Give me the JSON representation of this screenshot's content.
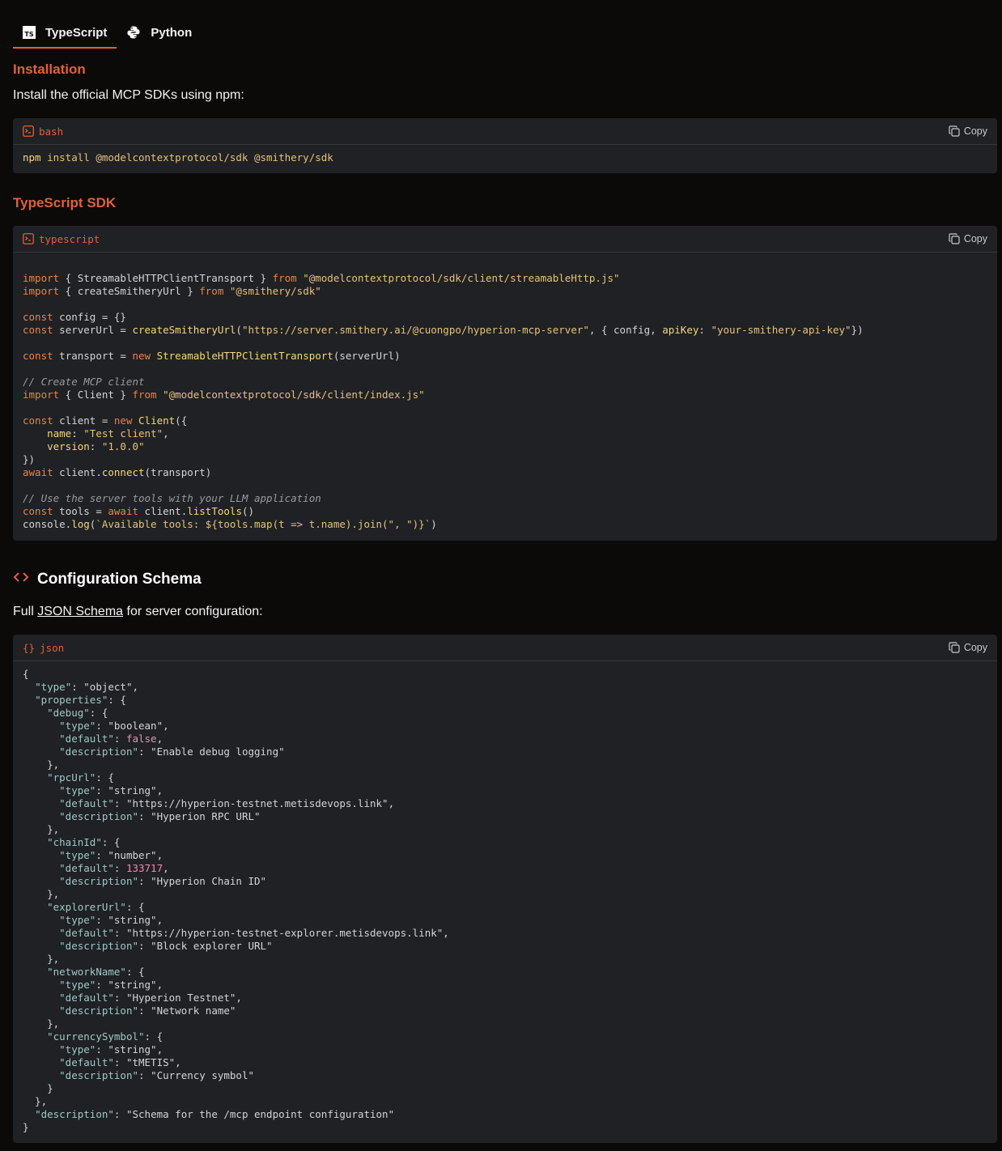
{
  "tabs": [
    {
      "label": "TypeScript",
      "active": true,
      "icon": "typescript-icon"
    },
    {
      "label": "Python",
      "active": false,
      "icon": "python-icon"
    }
  ],
  "installation": {
    "heading": "Installation",
    "text": "Install the official MCP SDKs using npm:",
    "block": {
      "lang": "bash",
      "copy": "Copy",
      "cmd": "npm",
      "args": "install @modelcontextprotocol/sdk @smithery/sdk"
    }
  },
  "ts_sdk": {
    "heading": "TypeScript SDK",
    "block": {
      "lang": "typescript",
      "copy": "Copy",
      "strings": {
        "transport_path": "\"@modelcontextprotocol/sdk/client/streamableHttp.js\"",
        "smithery_path": "\"@smithery/sdk\"",
        "server_url": "\"https://server.smithery.ai/@cuongpo/hyperion-mcp-server\"",
        "api_key": "\"your-smithery-api-key\"",
        "comment_create": "// Create MCP client",
        "client_path": "\"@modelcontextprotocol/sdk/client/index.js\"",
        "client_name": "\"Test client\"",
        "client_version": "\"1.0.0\"",
        "comment_use": "// Use the server tools with your LLM application",
        "log_template": "`Available tools: ${tools.map(t => t.name).join(\", \")}`"
      }
    }
  },
  "config_schema": {
    "heading": "Configuration Schema",
    "text_prefix": "Full ",
    "link": "JSON Schema",
    "text_suffix": " for server configuration:",
    "block": {
      "lang": "json",
      "copy": "Copy"
    },
    "properties": [
      {
        "name": "debug",
        "type": "boolean",
        "default": "false",
        "default_kind": "literal",
        "description": "Enable debug logging"
      },
      {
        "name": "rpcUrl",
        "type": "string",
        "default": "https://hyperion-testnet.metisdevops.link",
        "default_kind": "string",
        "description": "Hyperion RPC URL"
      },
      {
        "name": "chainId",
        "type": "number",
        "default": "133717",
        "default_kind": "literal",
        "description": "Hyperion Chain ID"
      },
      {
        "name": "explorerUrl",
        "type": "string",
        "default": "https://hyperion-testnet-explorer.metisdevops.link",
        "default_kind": "string",
        "description": "Block explorer URL"
      },
      {
        "name": "networkName",
        "type": "string",
        "default": "Hyperion Testnet",
        "default_kind": "string",
        "description": "Network name"
      },
      {
        "name": "currencySymbol",
        "type": "string",
        "default": "tMETIS",
        "default_kind": "string",
        "description": "Currency symbol"
      }
    ],
    "root_type": "object",
    "root_description": "Schema for the /mcp endpoint configuration"
  }
}
